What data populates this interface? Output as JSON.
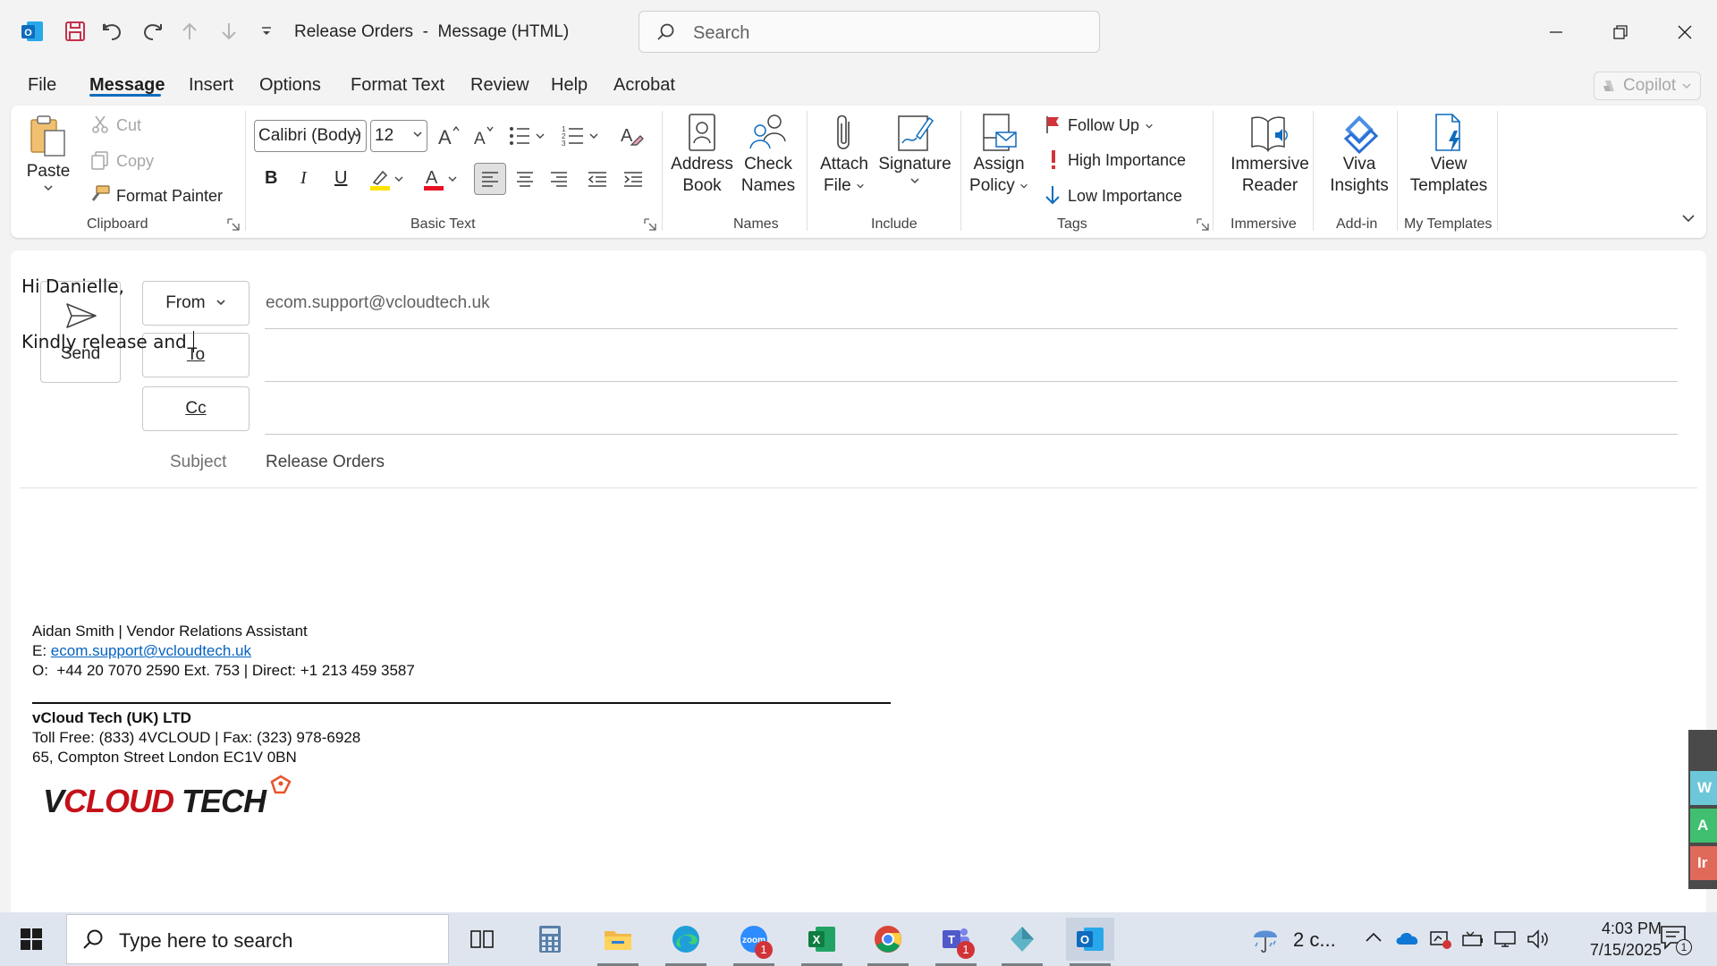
{
  "titlebar": {
    "title": "Release Orders  -  Message (HTML)",
    "search_placeholder": "Search"
  },
  "menu": {
    "tabs": [
      "File",
      "Message",
      "Insert",
      "Options",
      "Format Text",
      "Review",
      "Help",
      "Acrobat"
    ],
    "active_tab": "Message",
    "copilot": "Copilot"
  },
  "ribbon": {
    "clipboard": {
      "paste": "Paste",
      "cut": "Cut",
      "copy": "Copy",
      "format_painter": "Format Painter",
      "label": "Clipboard"
    },
    "basic_text": {
      "font": "Calibri (Body)",
      "size": "12",
      "label": "Basic Text",
      "bold": "B",
      "italic": "I",
      "underline": "U"
    },
    "names": {
      "address_book_1": "Address",
      "address_book_2": "Book",
      "check_names_1": "Check",
      "check_names_2": "Names",
      "label": "Names"
    },
    "include": {
      "attach_1": "Attach",
      "attach_2": "File",
      "signature": "Signature",
      "label": "Include"
    },
    "tags": {
      "assign_1": "Assign",
      "assign_2": "Policy",
      "follow_up": "Follow Up",
      "high": "High Importance",
      "low": "Low Importance",
      "label": "Tags"
    },
    "immersive": {
      "reader_1": "Immersive",
      "reader_2": "Reader",
      "label": "Immersive"
    },
    "addin": {
      "viva_1": "Viva",
      "viva_2": "Insights",
      "label": "Add-in"
    },
    "templates": {
      "view_1": "View",
      "view_2": "Templates",
      "label": "My Templates"
    }
  },
  "compose": {
    "send": "Send",
    "from_label": "From",
    "from_value": "ecom.support@vcloudtech.uk",
    "to_label": "To",
    "cc_label": "Cc",
    "subject_label": "Subject",
    "subject_value": "Release Orders"
  },
  "body": {
    "greeting": "Hi Danielle,",
    "line1": "Kindly release and "
  },
  "signature": {
    "name_line": "Aidan Smith | Vendor Relations Assistant",
    "email_prefix": "E: ",
    "email": "ecom.support@vcloudtech.uk",
    "phone_line": "O:  +44 20 7070 2590 Ext. 753 | Direct: +1 213 459 3587",
    "company": "vCloud Tech (UK) LTD",
    "tollfree_line": "Toll Free: (833) 4VCLOUD | Fax: (323) 978-6928",
    "address_line": "65, Compton Street London EC1V 0BN",
    "logo_text": "VCLOUD TECH"
  },
  "edge_tabs": [
    "W",
    "A",
    "Ir"
  ],
  "taskbar": {
    "search_placeholder": "Type here to search",
    "weather": "2 c...",
    "time": "4:03 PM",
    "date": "7/15/2025",
    "zoom_badge": "1",
    "teams_badge": "1",
    "notif_badge": "1"
  },
  "colors": {
    "accent": "#0f6cbd",
    "outlook_blue": "#0f6cbd",
    "link": "#0563c1",
    "flag_red": "#d13438"
  }
}
